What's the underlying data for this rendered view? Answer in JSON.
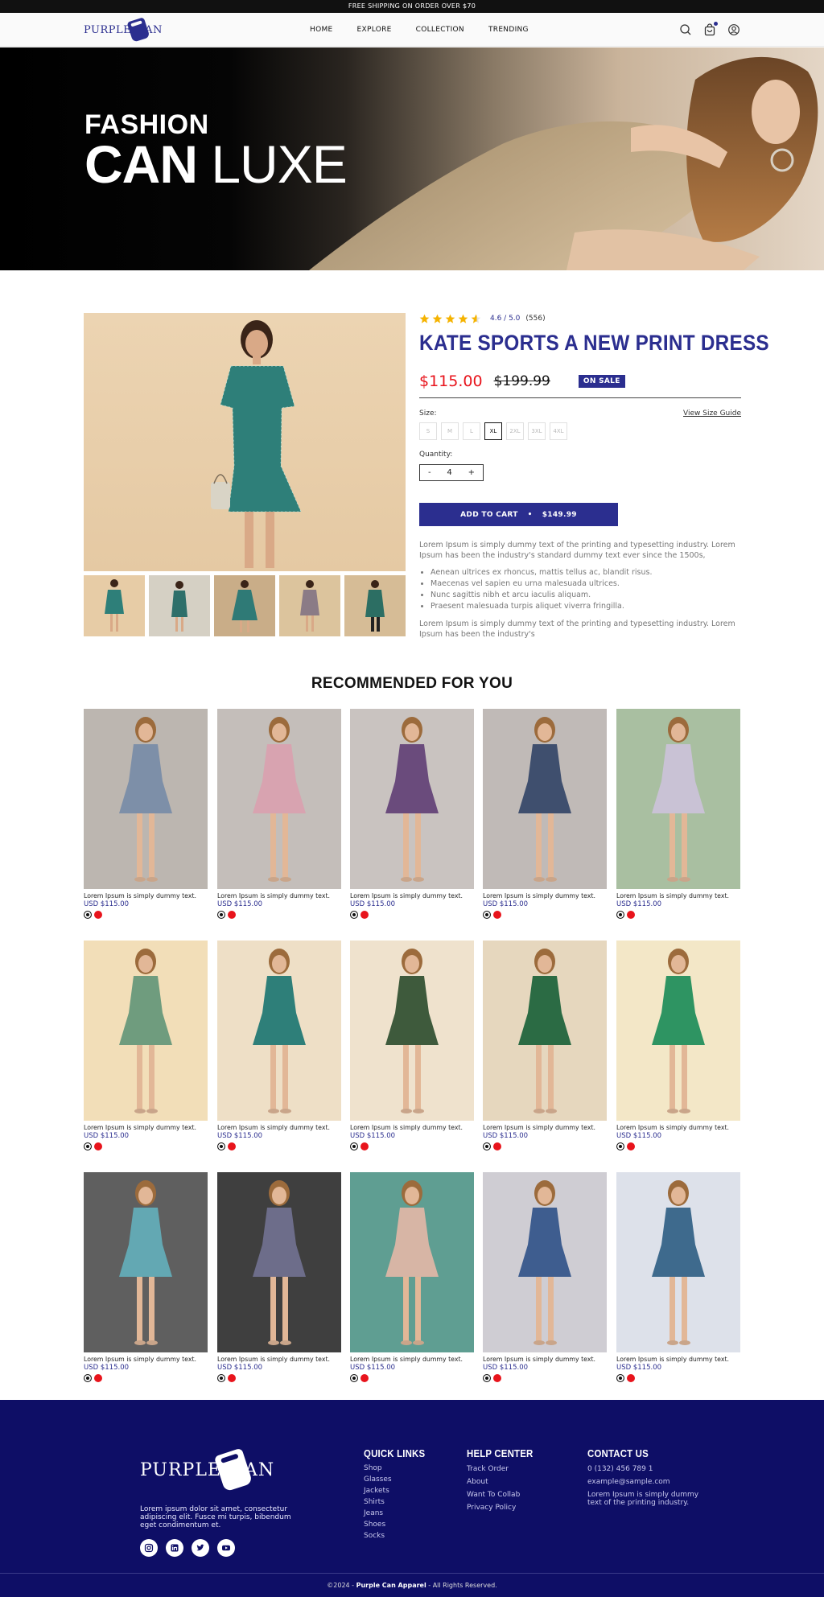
{
  "announcement": "FREE SHIPPING ON ORDER OVER $70",
  "brand": {
    "logo_left": "PURPLE",
    "logo_right": "AN"
  },
  "nav": {
    "items": [
      "HOME",
      "EXPLORE",
      "COLLECTION",
      "TRENDING"
    ]
  },
  "header_icons": [
    "search-icon",
    "cart-icon",
    "user-icon"
  ],
  "hero": {
    "line1": "FASHION",
    "line2_bold": "CAN",
    "line2_light": "LUXE"
  },
  "product": {
    "rating": "4.6 / 5.0",
    "rating_count": "(556)",
    "stars": 4.6,
    "title": "KATE SPORTS A NEW PRINT DRESS",
    "price": "$115.00",
    "old_price": "$199.99",
    "badge": "ON SALE",
    "size_label": "Size:",
    "size_guide": "View Size Guide",
    "sizes": [
      "S",
      "M",
      "L",
      "XL",
      "2XL",
      "3XL",
      "4XL"
    ],
    "selected_size": "XL",
    "quantity_label": "Quantity:",
    "qty_minus": "-",
    "quantity": "4",
    "qty_plus": "+",
    "add_to_cart": "ADD TO CART",
    "cart_sep": "•",
    "cart_price": "$149.99",
    "description": "Lorem Ipsum is simply dummy text of the printing and typesetting industry. Lorem Ipsum has been the industry's standard dummy text ever since the 1500s,",
    "bullets": [
      "Aenean ultrices ex rhoncus, mattis tellus ac, blandit risus.",
      "Maecenas vel sapien eu urna malesuada ultrices.",
      "Nunc sagittis nibh et arcu iaculis aliquam.",
      "Praesent malesuada turpis aliquet viverra fringilla."
    ],
    "description2": "Lorem Ipsum is simply dummy text of the printing and typesetting industry. Lorem Ipsum has been the industry's"
  },
  "recommended": {
    "title": "RECOMMENDED FOR YOU",
    "items": [
      {
        "name": "Lorem Ipsum is simply dummy text.",
        "price": "USD $115.00"
      },
      {
        "name": "Lorem Ipsum is simply dummy text.",
        "price": "USD $115.00"
      },
      {
        "name": "Lorem Ipsum is simply dummy text.",
        "price": "USD $115.00"
      },
      {
        "name": "Lorem Ipsum is simply dummy text.",
        "price": "USD $115.00"
      },
      {
        "name": "Lorem Ipsum is simply dummy text.",
        "price": "USD $115.00"
      },
      {
        "name": "Lorem Ipsum is simply dummy text.",
        "price": "USD $115.00"
      },
      {
        "name": "Lorem Ipsum is simply dummy text.",
        "price": "USD $115.00"
      },
      {
        "name": "Lorem Ipsum is simply dummy text.",
        "price": "USD $115.00"
      },
      {
        "name": "Lorem Ipsum is simply dummy text.",
        "price": "USD $115.00"
      },
      {
        "name": "Lorem Ipsum is simply dummy text.",
        "price": "USD $115.00"
      },
      {
        "name": "Lorem Ipsum is simply dummy text.",
        "price": "USD $115.00"
      },
      {
        "name": "Lorem Ipsum is simply dummy text.",
        "price": "USD $115.00"
      },
      {
        "name": "Lorem Ipsum is simply dummy text.",
        "price": "USD $115.00"
      },
      {
        "name": "Lorem Ipsum is simply dummy text.",
        "price": "USD $115.00"
      },
      {
        "name": "Lorem Ipsum is simply dummy text.",
        "price": "USD $115.00"
      }
    ]
  },
  "footer": {
    "about": "Lorem ipsum dolor sit amet, consectetur adipiscing elit. Fusce mi turpis, bibendum eget condimentum et.",
    "socials": [
      "instagram-icon",
      "linkedin-icon",
      "twitter-icon",
      "youtube-icon"
    ],
    "quick_links": {
      "title": "QUICK LINKS",
      "items": [
        "Shop",
        "Glasses",
        "Jackets",
        "Shirts",
        "Jeans",
        "Shoes",
        "Socks"
      ]
    },
    "help_center": {
      "title": "HELP CENTER",
      "items": [
        "Track Order",
        "About",
        "Want To Collab",
        "Privacy Policy"
      ]
    },
    "contact": {
      "title": "CONTACT US",
      "phone": "0 (132) 456 789 1",
      "email": "example@sample.com",
      "note": "Lorem Ipsum is simply dummy text of the printing  industry."
    },
    "copyright_prefix": "©2024 - ",
    "copyright_brand": "Purple Can Apparel",
    "copyright_suffix": " - All Rights Reserved."
  },
  "colors": {
    "brand": "#2b2e8f",
    "sale_price": "#e8141c",
    "footer_bg": "#0e0e66",
    "star": "#f5b301"
  }
}
